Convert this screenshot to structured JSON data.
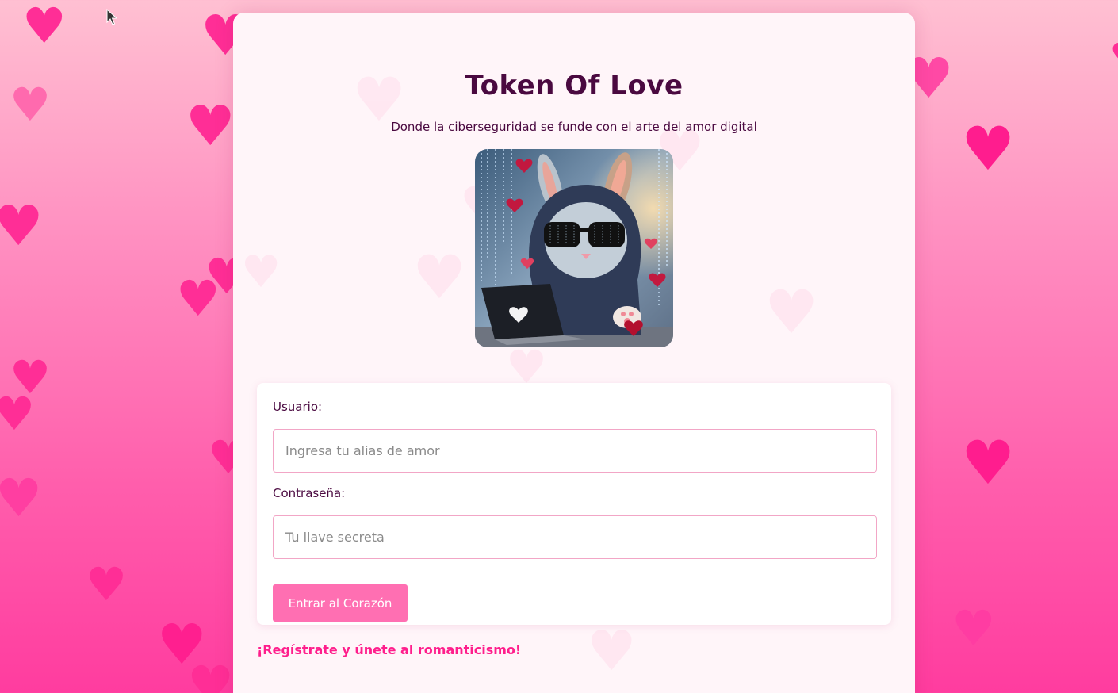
{
  "header": {
    "title": "Token Of Love",
    "subtitle": "Donde la ciberseguridad se funde con el arte del amor digital"
  },
  "form": {
    "username_label": "Usuario:",
    "username_placeholder": "Ingresa tu alias de amor",
    "password_label": "Contraseña:",
    "password_placeholder": "Tu llave secreta",
    "submit_label": "Entrar al Corazón"
  },
  "register_link": "¡Regístrate y únete al romanticismo!",
  "colors": {
    "accent": "#ff6fb2",
    "title_text": "#4a0940",
    "link": "#ff1e8c",
    "heart": "#ff2e96"
  },
  "icons": {
    "background": "heart-icon",
    "cursor": "mouse-cursor-icon"
  }
}
